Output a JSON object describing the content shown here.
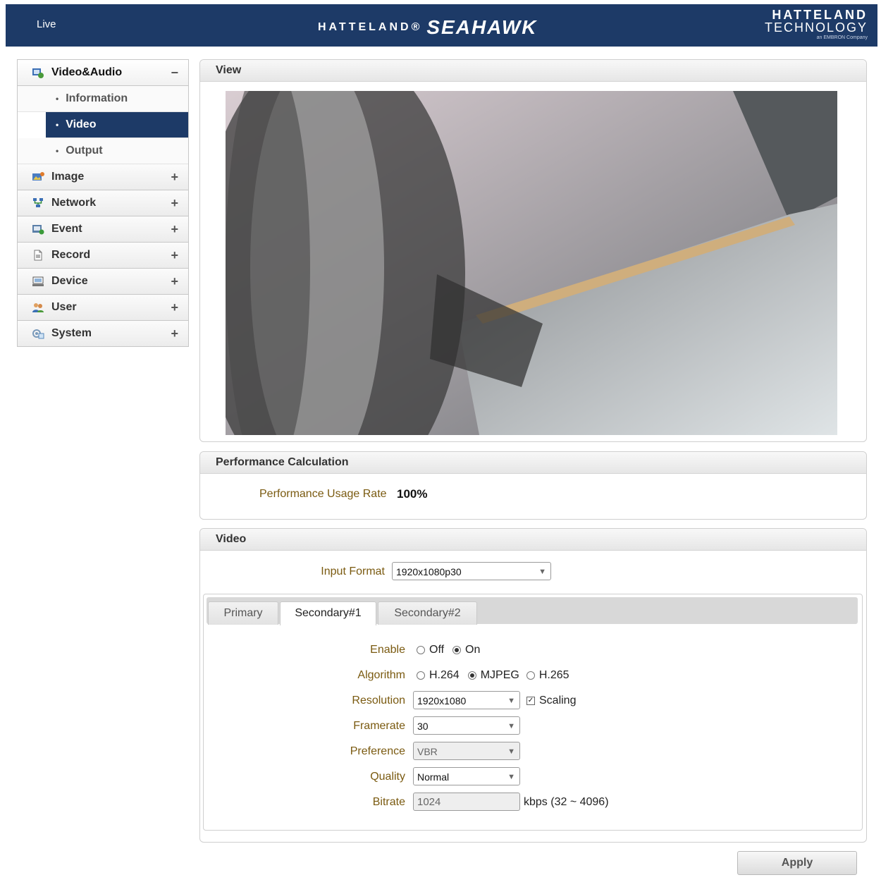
{
  "header": {
    "live_label": "Live",
    "brand_prefix": "HATTELAND®",
    "brand_product": "SEAHAWK",
    "logo_line1": "HATTELAND",
    "logo_line2": "TECHNOLOGY",
    "logo_line3": "an EMBRON Company",
    "bg_color": "#1d3a67"
  },
  "sidebar": {
    "sections": [
      {
        "label": "Video&Audio",
        "toggle": "−",
        "icon": "video-audio-icon",
        "expanded": true,
        "items": [
          {
            "label": "Information",
            "active": false
          },
          {
            "label": "Video",
            "active": true
          },
          {
            "label": "Output",
            "active": false
          }
        ]
      },
      {
        "label": "Image",
        "toggle": "+",
        "icon": "image-icon"
      },
      {
        "label": "Network",
        "toggle": "+",
        "icon": "network-icon"
      },
      {
        "label": "Event",
        "toggle": "+",
        "icon": "event-icon"
      },
      {
        "label": "Record",
        "toggle": "+",
        "icon": "record-icon"
      },
      {
        "label": "Device",
        "toggle": "+",
        "icon": "device-icon"
      },
      {
        "label": "User",
        "toggle": "+",
        "icon": "user-icon"
      },
      {
        "label": "System",
        "toggle": "+",
        "icon": "system-icon"
      }
    ]
  },
  "view": {
    "title": "View"
  },
  "performance": {
    "title": "Performance Calculation",
    "usage_label": "Performance Usage Rate",
    "usage_value": "100%"
  },
  "video": {
    "title": "Video",
    "input_format_label": "Input Format",
    "input_format_value": "1920x1080p30",
    "tabs": [
      {
        "label": "Primary",
        "active": false
      },
      {
        "label": "Secondary#1",
        "active": true
      },
      {
        "label": "Secondary#2",
        "active": false
      }
    ],
    "enable": {
      "label": "Enable",
      "options": [
        "Off",
        "On"
      ],
      "selected": "On"
    },
    "algorithm": {
      "label": "Algorithm",
      "options": [
        "H.264",
        "MJPEG",
        "H.265"
      ],
      "selected": "MJPEG"
    },
    "resolution": {
      "label": "Resolution",
      "value": "1920x1080",
      "scaling_label": "Scaling",
      "scaling_checked": true
    },
    "framerate": {
      "label": "Framerate",
      "value": "30"
    },
    "preference": {
      "label": "Preference",
      "value": "VBR"
    },
    "quality": {
      "label": "Quality",
      "value": "Normal"
    },
    "bitrate": {
      "label": "Bitrate",
      "value": "1024",
      "unit": "kbps (32 ~ 4096)"
    }
  },
  "apply_label": "Apply"
}
